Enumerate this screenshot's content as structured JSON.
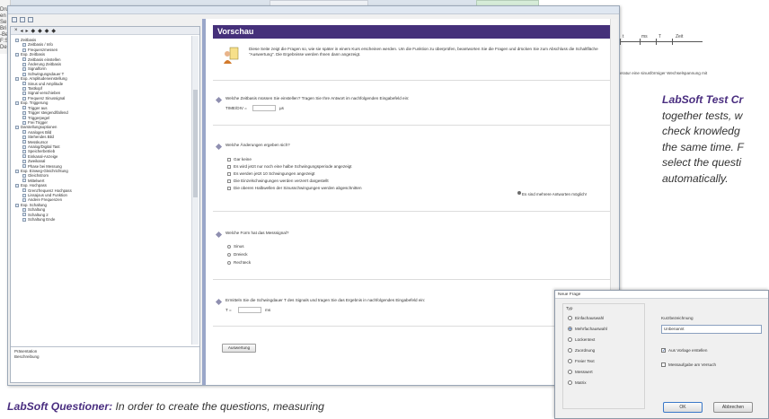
{
  "left_strip": {
    "lines": [
      "Dru",
      "en",
      "Se",
      "Bri",
      "-Be",
      "F:S",
      "Del"
    ]
  },
  "toolbar_left": {
    "buttons": [
      "×",
      "◂",
      "▸",
      "◆",
      "◆",
      "◆",
      "◆"
    ]
  },
  "tree": {
    "items": [
      {
        "label": "Zeitbasis",
        "level": 0
      },
      {
        "label": "Zeitbasis / Info",
        "level": 1
      },
      {
        "label": "Frequenzmessen",
        "level": 1
      },
      {
        "label": "Exp. Zeitbasis",
        "level": 0
      },
      {
        "label": "Zeitbasis einstellen",
        "level": 1
      },
      {
        "label": "Änderung Zeitbasis",
        "level": 1
      },
      {
        "label": "Signalform",
        "level": 1
      },
      {
        "label": "Schwingungsdauer T",
        "level": 1
      },
      {
        "label": "Exp. Amplitudeneinstellung",
        "level": 0
      },
      {
        "label": "Sinus und Amplitude",
        "level": 1
      },
      {
        "label": "Tastkopf",
        "level": 1
      },
      {
        "label": "Signal verschieben",
        "level": 1
      },
      {
        "label": "Frequenz Sinussignal",
        "level": 1
      },
      {
        "label": "Exp. Triggerung",
        "level": 0
      },
      {
        "label": "Trigger aus",
        "level": 1
      },
      {
        "label": "Trigger steigend/fallend",
        "level": 1
      },
      {
        "label": "Triggerpegel",
        "level": 1
      },
      {
        "label": "Frei Trigger",
        "level": 1
      },
      {
        "label": "Darstellungsoptionen",
        "level": 0
      },
      {
        "label": "Analoges Bild",
        "level": 1
      },
      {
        "label": "Stehendes Bild",
        "level": 1
      },
      {
        "label": "Messkursor",
        "level": 1
      },
      {
        "label": "Analog/Digital Tast",
        "level": 1
      },
      {
        "label": "Speicherbetrieb",
        "level": 1
      },
      {
        "label": "Einkanal-Anzeige",
        "level": 1
      },
      {
        "label": "Zweikanal",
        "level": 1
      },
      {
        "label": "Phase bei Messung",
        "level": 1
      },
      {
        "label": "Exp. Einweg-Gleichrichtung",
        "level": 0
      },
      {
        "label": "Gleichstrom",
        "level": 1
      },
      {
        "label": "Mittelwert",
        "level": 1
      },
      {
        "label": "Exp. Hochpass",
        "level": 0
      },
      {
        "label": "Grenzfrequenz Hochpass",
        "level": 1
      },
      {
        "label": "Lissajous und Funktion",
        "level": 1
      },
      {
        "label": "Andere Frequenzen",
        "level": 1
      },
      {
        "label": "Exp. Schaltung",
        "level": 0
      },
      {
        "label": "Schaltung",
        "level": 1
      },
      {
        "label": "Schaltung 2",
        "level": 1
      },
      {
        "label": "Schaltung Ende",
        "level": 1
      }
    ]
  },
  "bottom_list": {
    "items": [
      "Präsentation",
      "Beschreibung"
    ]
  },
  "preview": {
    "title": "Vorschau",
    "intro": "Diese Seite zeigt die Fragen so, wie sie später in einem Kurs erscheinen werden. Um die Funktion zu überprüfen, beantworten Sie die Fragen und drücken Sie zum Abschluss die Schaltfläche \"Auswertung\". Die Ergebnisse werden Ihnen dann angezeigt.",
    "q1": {
      "text": "Welche Zeitbasis müssen Sie einstellen? Tragen Sie Ihre Antwort im nachfolgenden Eingabefeld ein:",
      "prefix": "TIME/DIV =",
      "unit": "µs"
    },
    "q2": {
      "text": "Welche Änderungen ergeben sich?",
      "options": [
        "Gar keine",
        "Es wird jetzt nur noch eine halbe Schwingungsperiode angezeigt",
        "Es werden jetzt 10 Schwingungen angezeigt",
        "Die Einzelschwingungen werden verzerrt dargestellt",
        "Die oberen Halbwellen der Sinusschwingungen werden abgeschnitten"
      ],
      "hint": "Es sind mehrere Antworten möglich!"
    },
    "q3": {
      "text": "Welche Form hat das Messsignal?",
      "options": [
        "Sinus",
        "Dreieck",
        "Rechteck"
      ]
    },
    "q4": {
      "text": "Ermitteln Sie die Schwingdauer T des Signals und tragen Sie das Ergebnis in nachfolgendes Eingabefeld ein:",
      "prefix": "T =",
      "unit": "ms"
    },
    "eval_button": "Auswertung"
  },
  "chart_fragment": {
    "tick_labels": [
      "t",
      "ms",
      "T",
      "Zeit"
    ],
    "caption": "eratur eine sinusförmiger Wechselspannung mit"
  },
  "caption_right": {
    "bold": "LabSoft Test Cr",
    "lines": [
      "together tests, w",
      "check knowledg",
      "the same time. F",
      "select the questi",
      "automatically."
    ]
  },
  "caption_bottom": {
    "bold": "LabSoft Questioner:",
    "text": " In order to create the questions, measuring"
  },
  "dialog": {
    "title": "Neue Frage",
    "type_label": "Typ",
    "types": [
      {
        "label": "Einfachauswahl",
        "selected": false
      },
      {
        "label": "Mehrfachauswahl",
        "selected": true
      },
      {
        "label": "Lückentext",
        "selected": false
      },
      {
        "label": "Zuordnung",
        "selected": false
      },
      {
        "label": "Freier Text",
        "selected": false
      },
      {
        "label": "Messwert",
        "selected": false
      },
      {
        "label": "Matrix",
        "selected": false
      }
    ],
    "short_label": "Kurzbezeichnung",
    "short_value": "Unbenannt",
    "checks": [
      {
        "label": "Aus Vorlage erstellen",
        "checked": true
      },
      {
        "label": "Messaufgabe am Versuch",
        "checked": false
      }
    ],
    "ok_label": "OK",
    "cancel_label": "Abbrechen"
  }
}
